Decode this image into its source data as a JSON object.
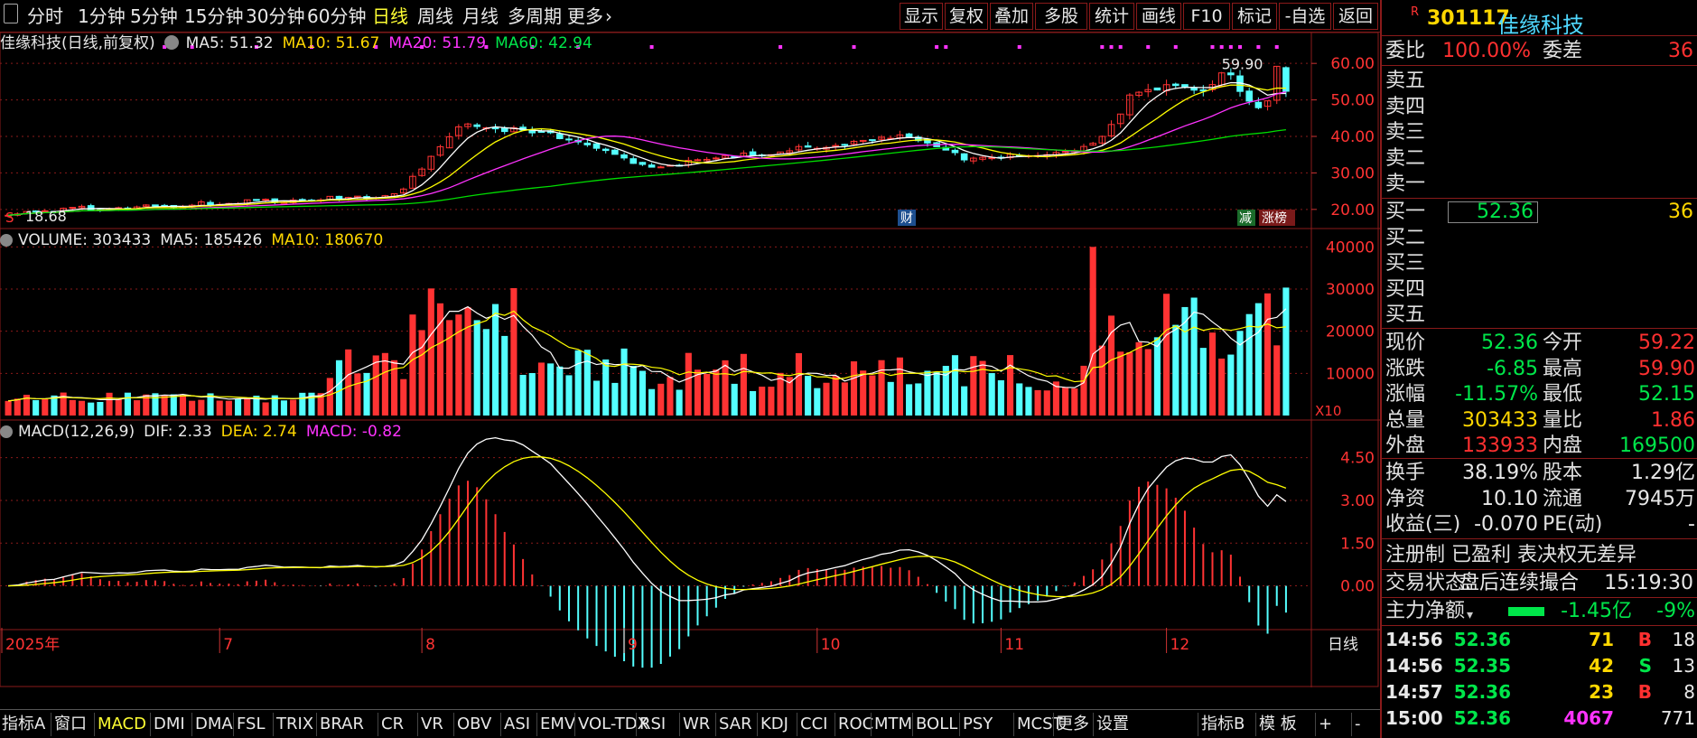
{
  "toolbar": {
    "left_items": [
      "分时",
      "1分钟",
      "5分钟",
      "15分钟",
      "30分钟",
      "60分钟",
      "日线",
      "周线",
      "月线",
      "多周期",
      "更多"
    ],
    "active": "日线",
    "right_items": [
      "显示",
      "复权",
      "叠加",
      "多股",
      "统计",
      "画线",
      "F10",
      "标记",
      "-自选",
      "返回"
    ]
  },
  "stock": {
    "code": "301117",
    "name": "佳缘科技",
    "badge": "R"
  },
  "legends": {
    "main": {
      "title": "佳缘科技(日线,前复权)",
      "ma5": "MA5: 51.32",
      "ma10": "MA10: 51.67",
      "ma20": "MA20: 51.79",
      "ma60": "MA60: 42.94"
    },
    "volume": {
      "title": "VOLUME: 303433",
      "ma5": "MA5: 185426",
      "ma10": "MA10: 180670"
    },
    "macd": {
      "title": "MACD(12,26,9)",
      "dif": "DIF: 2.33",
      "dea": "DEA: 2.74",
      "macd": "MACD: -0.82"
    }
  },
  "price_axis": [
    "60.00",
    "50.00",
    "40.00",
    "30.00",
    "20.00"
  ],
  "volume_axis": [
    "40000",
    "30000",
    "20000",
    "10000"
  ],
  "volume_unit": "X10",
  "macd_axis": [
    "4.50",
    "3.00",
    "1.50",
    "0.00"
  ],
  "date_labels": [
    "2025年",
    "7",
    "8",
    "9",
    "10",
    "11",
    "12"
  ],
  "period_label": "日线",
  "markers": {
    "high": "59.90",
    "low": "18.68",
    "cai": "财",
    "jian": "减",
    "zhangbang": "涨榜",
    "s": "S"
  },
  "bottom": {
    "items": [
      "指标A",
      "窗口",
      "MACD",
      "DMI",
      "DMA",
      "FSL",
      "TRIX",
      "BRAR",
      "CR",
      "VR",
      "OBV",
      "ASI",
      "EMV",
      "VOL-TDX",
      "RSI",
      "WR",
      "SAR",
      "KDJ",
      "CCI",
      "ROC",
      "MTM",
      "BOLL",
      "PSY",
      "MCST",
      "更多",
      "设置",
      "指标B",
      "模 板",
      "+",
      "-"
    ],
    "active": "MACD"
  },
  "panel": {
    "weibi": {
      "label": "委比",
      "value": "100.00%",
      "label2": "委差",
      "value2": "36"
    },
    "sells": [
      "卖五",
      "卖四",
      "卖三",
      "卖二",
      "卖一"
    ],
    "buys": [
      {
        "label": "买一",
        "price": "52.36",
        "vol": "36"
      },
      {
        "label": "买二",
        "price": "",
        "vol": ""
      },
      {
        "label": "买三",
        "price": "",
        "vol": ""
      },
      {
        "label": "买四",
        "price": "",
        "vol": ""
      },
      {
        "label": "买五",
        "price": "",
        "vol": ""
      }
    ],
    "quote": [
      {
        "l": "现价",
        "v": "52.36",
        "vc": "green",
        "l2": "今开",
        "v2": "59.22",
        "vc2": "red"
      },
      {
        "l": "涨跌",
        "v": "-6.85",
        "vc": "green",
        "l2": "最高",
        "v2": "59.90",
        "vc2": "red"
      },
      {
        "l": "涨幅",
        "v": "-11.57%",
        "vc": "green",
        "l2": "最低",
        "v2": "52.15",
        "vc2": "green"
      },
      {
        "l": "总量",
        "v": "303433",
        "vc": "yellow",
        "l2": "量比",
        "v2": "1.86",
        "vc2": "red"
      },
      {
        "l": "外盘",
        "v": "133933",
        "vc": "red",
        "l2": "内盘",
        "v2": "169500",
        "vc2": "green"
      }
    ],
    "stats": [
      {
        "l": "换手",
        "v": "38.19%",
        "l2": "股本",
        "v2": "1.29亿"
      },
      {
        "l": "净资",
        "v": "10.10",
        "l2": "流通",
        "v2": "7945万"
      },
      {
        "l": "收益(三)",
        "v": "-0.070",
        "l2": "PE(动)",
        "v2": "-"
      }
    ],
    "note": "注册制 已盈利 表决权无差异",
    "status_label": "交易状态:",
    "status": "盘后连续撮合",
    "status_time": "15:19:30",
    "net": {
      "label": "主力净额",
      "value": "-1.45亿",
      "pct": "-9%"
    },
    "ticks": [
      {
        "t": "14:56",
        "p": "52.36",
        "v": "71",
        "bs": "B",
        "n": "18"
      },
      {
        "t": "14:56",
        "p": "52.35",
        "v": "42",
        "bs": "S",
        "n": "13"
      },
      {
        "t": "14:57",
        "p": "52.36",
        "v": "23",
        "bs": "B",
        "n": "8"
      },
      {
        "t": "15:00",
        "p": "52.36",
        "v": "4067",
        "bs": "",
        "n": "771"
      }
    ]
  },
  "colors": {
    "up": "#ff3333",
    "down": "#54ffff",
    "ma5": "#ffffff",
    "ma10": "#ffff00",
    "ma20": "#ff33ff",
    "ma60": "#00dd00",
    "frame": "#8a1a1a"
  }
}
